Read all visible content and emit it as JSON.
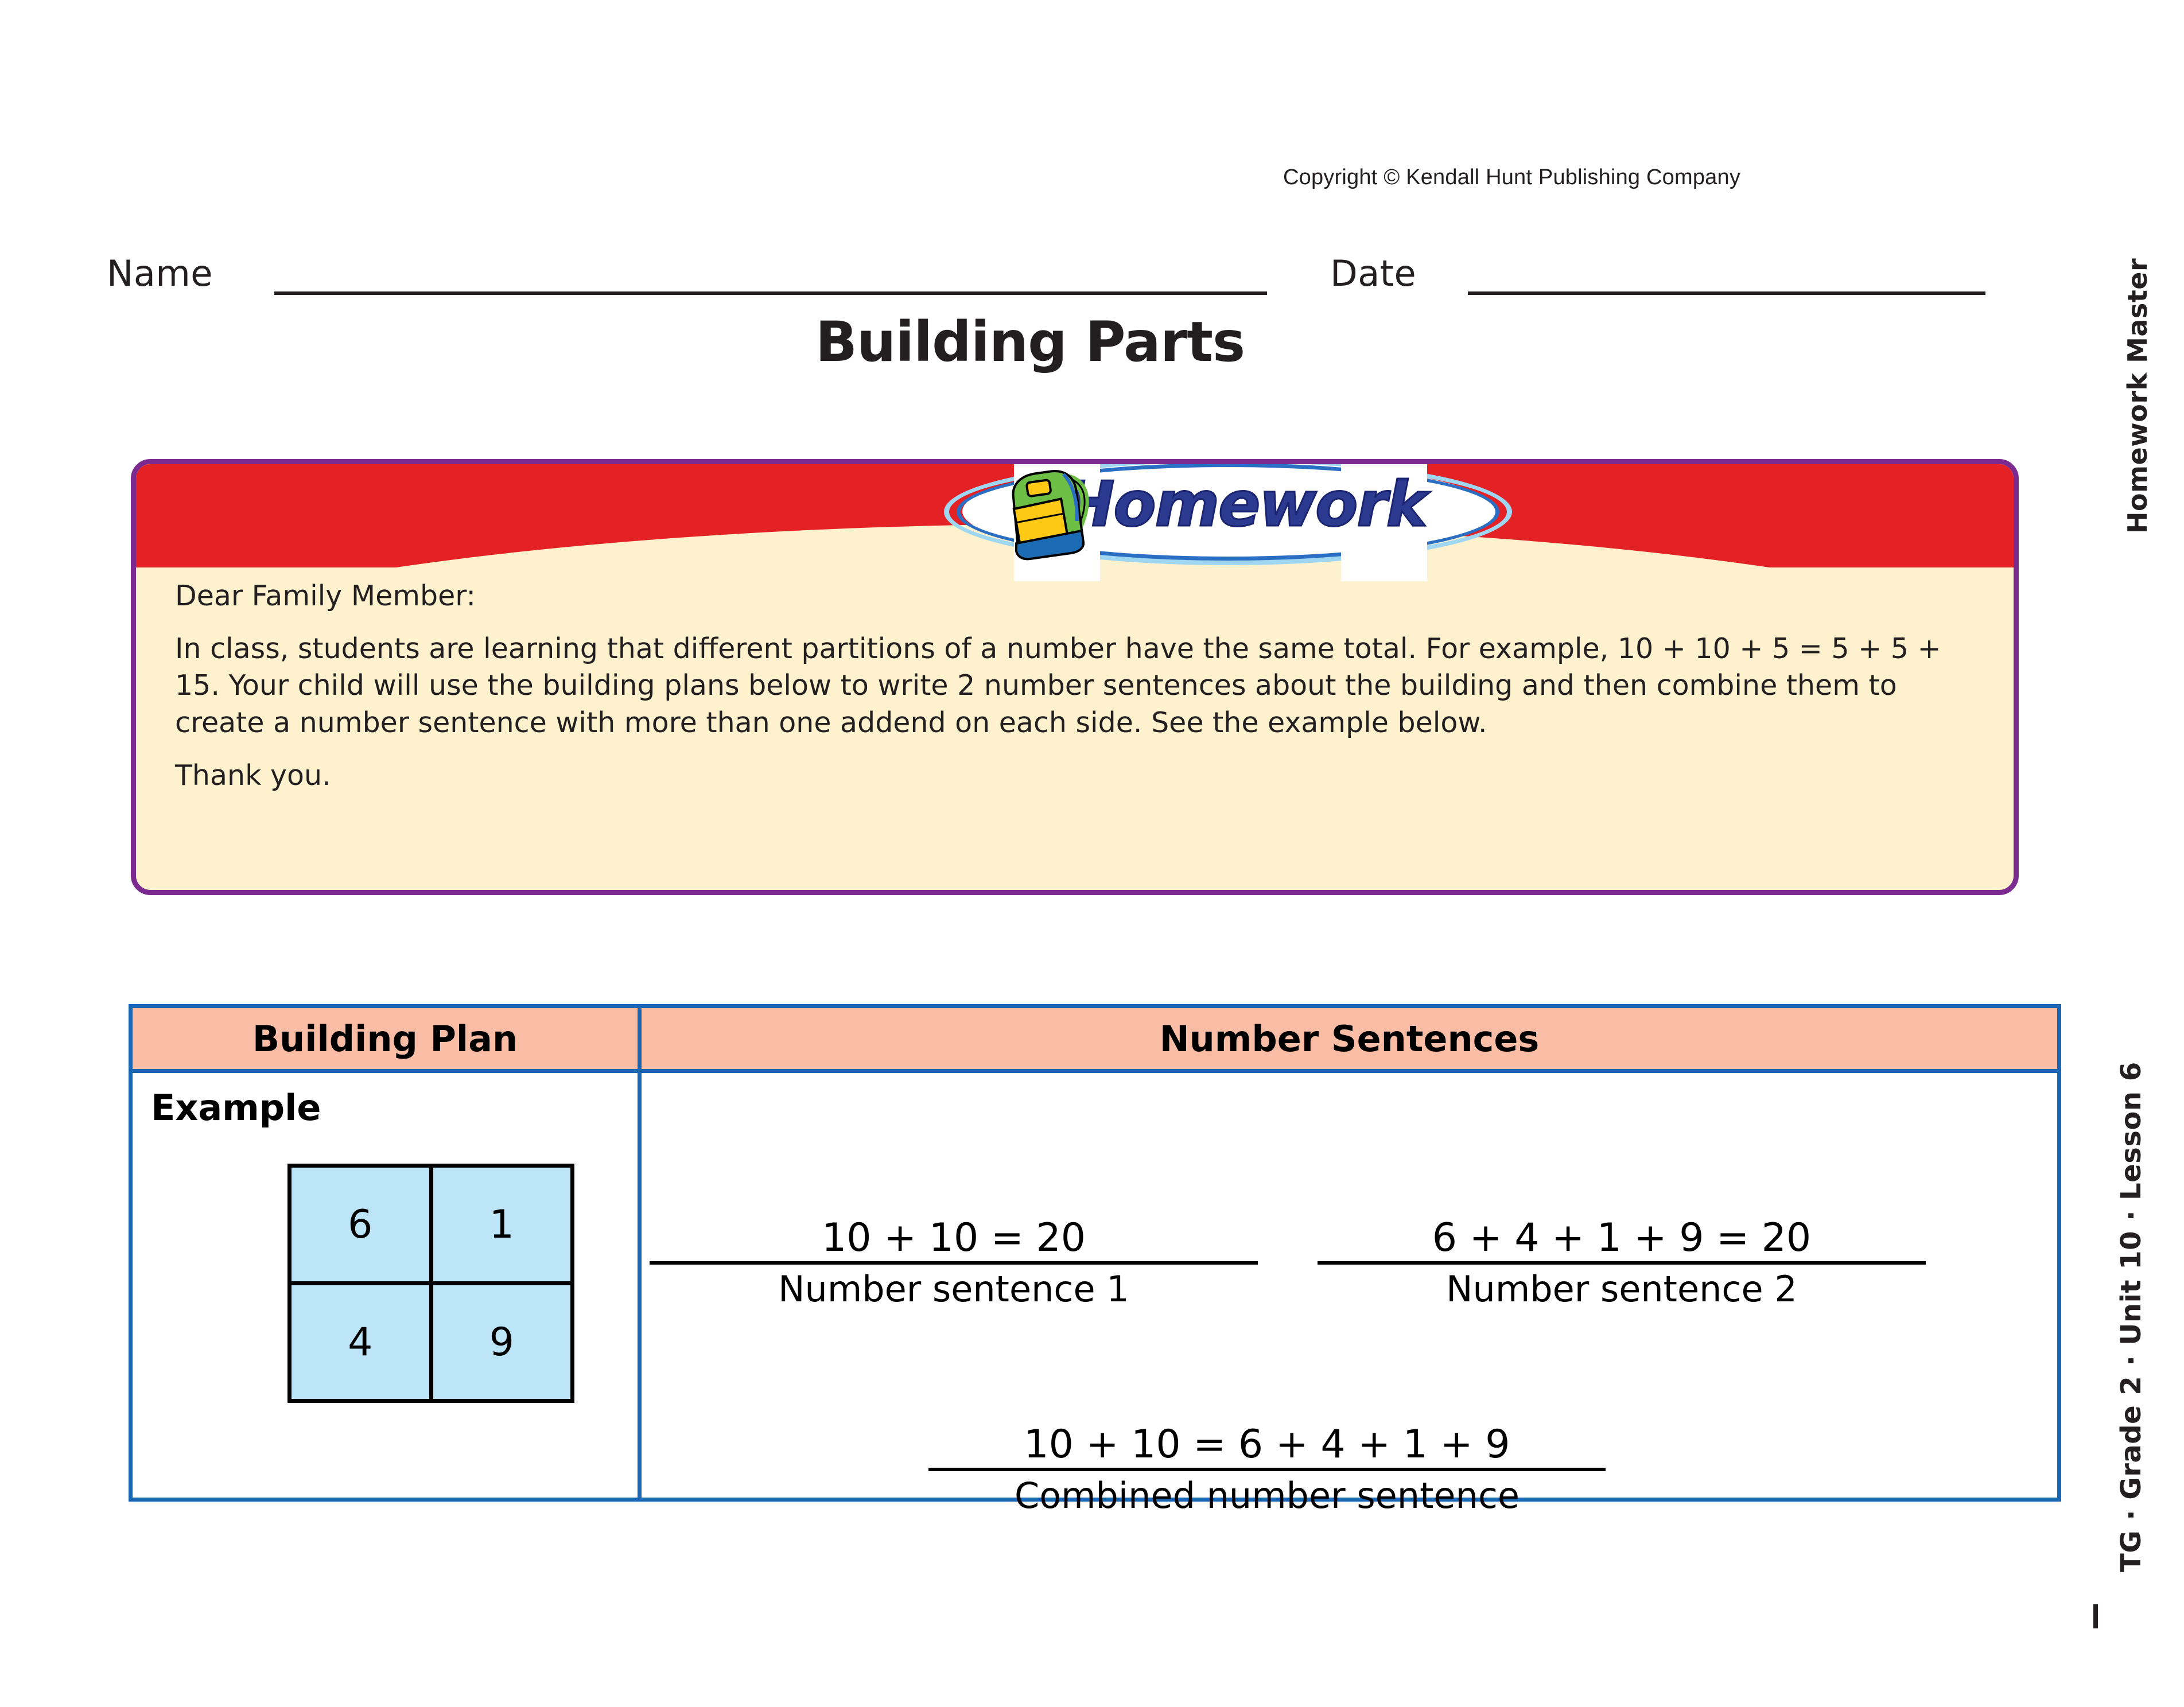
{
  "copyright": "Copyright © Kendall Hunt Publishing Company",
  "header": {
    "name_label": "Name",
    "date_label": "Date"
  },
  "title": "Building Parts",
  "letter": {
    "logo_text": "Homework",
    "logo_icon": "backpack-icon",
    "salutation": "Dear Family Member:",
    "paragraph": "In class, students are learning that different partitions of a number have the same total. For example, 10 + 10 + 5 = 5 + 5 + 15. Your child will use the building plans below to write 2 number sentences about the building and then combine them to create a number sentence with more than one addend on each side. See the example below.",
    "closing": "Thank you."
  },
  "table": {
    "headers": [
      "Building Plan",
      "Number Sentences"
    ],
    "row": {
      "example_label": "Example",
      "grid": [
        [
          "6",
          "1"
        ],
        [
          "4",
          "9"
        ]
      ],
      "sentence_1": {
        "answer": "10 + 10 = 20",
        "caption": "Number sentence 1"
      },
      "sentence_2": {
        "answer": "6 + 4 + 1 + 9 = 20",
        "caption": "Number sentence 2"
      },
      "combined": {
        "answer": "10 + 10 = 6 + 4 + 1 + 9",
        "caption": "Combined number sentence"
      }
    }
  },
  "margin": {
    "master_label": "Homework Master",
    "lesson_label": "TG · Grade 2 · Unit 10 · Lesson 6"
  },
  "colors": {
    "banner_red": "#e42226",
    "letter_cream": "#fdf1ce",
    "letter_border_purple": "#7b2a8f",
    "table_border_blue": "#1a66b3",
    "table_header_peach": "#f9bda6",
    "grid_cell_blue": "#bde5f8",
    "logo_text_blue": "#2b3a8f"
  }
}
